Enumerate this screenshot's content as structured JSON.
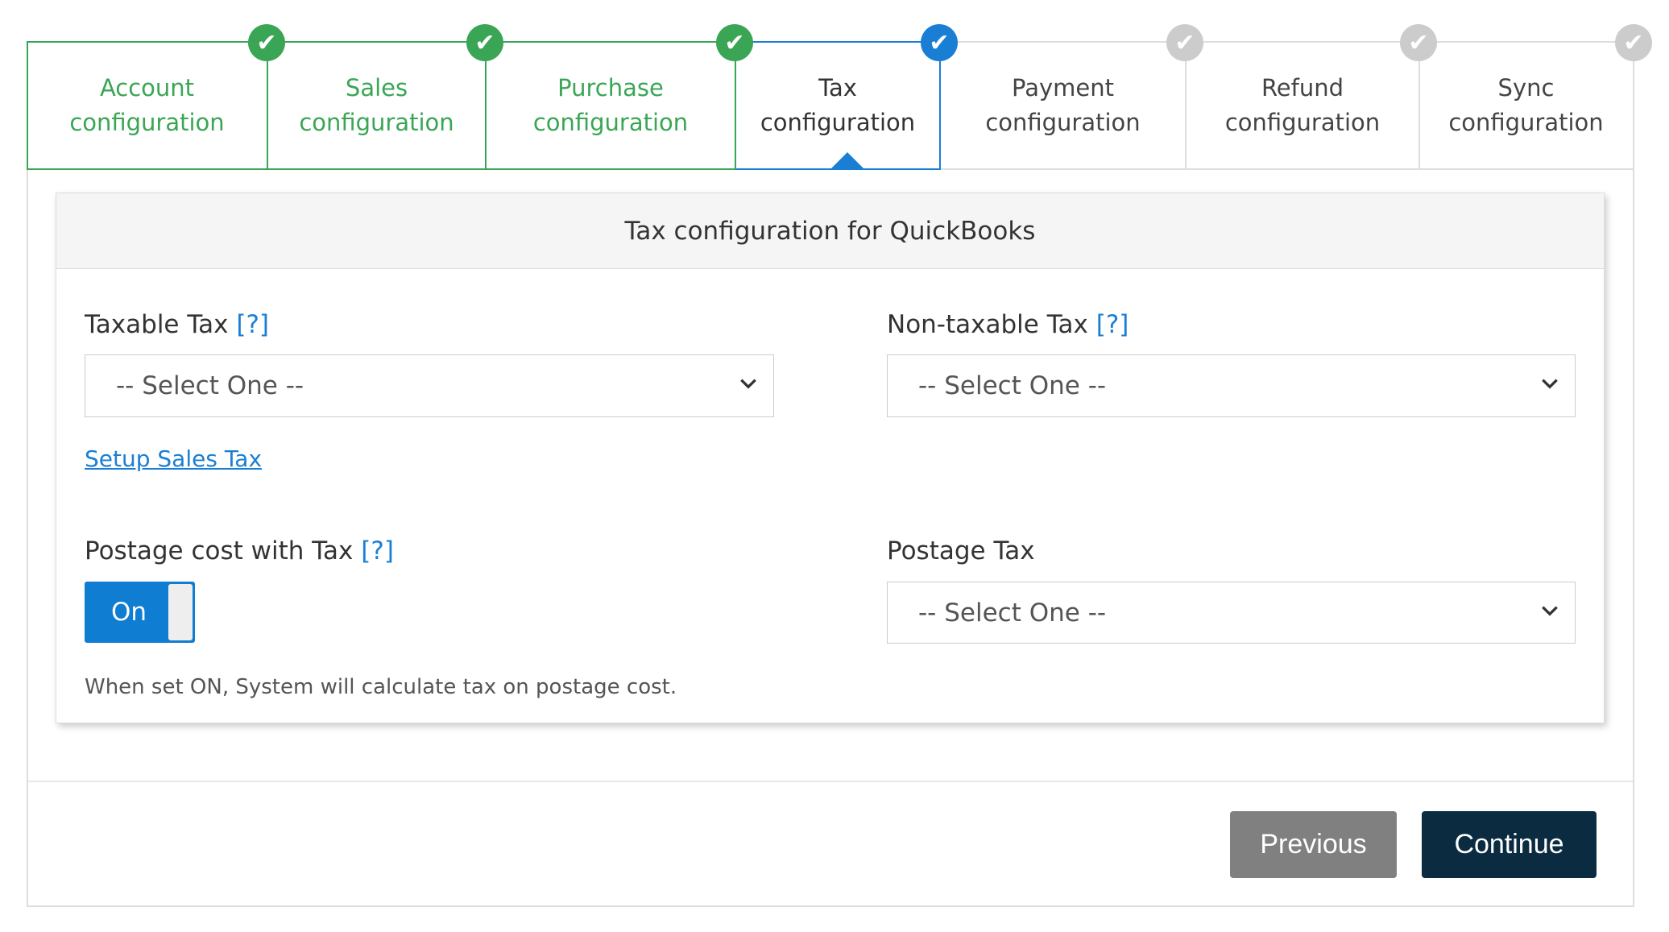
{
  "steps": [
    {
      "label1": "Account",
      "label2": "configuration",
      "state": "done"
    },
    {
      "label1": "Sales",
      "label2": "configuration",
      "state": "done"
    },
    {
      "label1": "Purchase",
      "label2": "configuration",
      "state": "done"
    },
    {
      "label1": "Tax",
      "label2": "configuration",
      "state": "active"
    },
    {
      "label1": "Payment",
      "label2": "configuration",
      "state": "pending"
    },
    {
      "label1": "Refund",
      "label2": "configuration",
      "state": "pending"
    },
    {
      "label1": "Sync",
      "label2": "configuration",
      "state": "pending"
    }
  ],
  "check_icon": "✔",
  "panel": {
    "title": "Tax configuration for QuickBooks"
  },
  "form": {
    "taxable_tax": {
      "label": "Taxable Tax",
      "help": "[?]",
      "value": "-- Select One --"
    },
    "non_taxable_tax": {
      "label": "Non-taxable Tax",
      "help": "[?]",
      "value": "-- Select One --"
    },
    "setup_link": "Setup Sales Tax",
    "postage_cost": {
      "label": "Postage cost with Tax",
      "help": "[?]",
      "toggle": "On",
      "note": "When set ON, System will calculate tax on postage cost."
    },
    "postage_tax": {
      "label": "Postage Tax",
      "value": "-- Select One --"
    }
  },
  "buttons": {
    "previous": "Previous",
    "continue": "Continue"
  },
  "colors": {
    "done": "#3aa655",
    "active": "#1a7fd4",
    "pending": "#cccccc",
    "continue_bg": "#0b2c40",
    "previous_bg": "#808080"
  }
}
